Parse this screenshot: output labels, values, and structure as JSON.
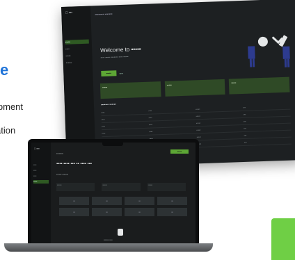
{
  "background_text": {
    "heading": "e",
    "line1": "ipment",
    "line2": "ation"
  },
  "monitor": {
    "sidebar": {
      "logo": "□ ▪▪▪",
      "items": [
        "▪▪▪▪▪",
        "▪▪▪▪",
        "▪▪▪▪▪",
        "▪▪▪▪▪▪"
      ]
    },
    "header": "▪▪▪▪▪▪▪▪    ▪▪▪▪▪▪▪",
    "hero": {
      "title": "Welcome to ▪▪▪▪▪",
      "subtitle": "▪▪▪▪ ▪▪▪▪▪ ▪▪▪▪▪▪▪ ▪▪▪▪ ▪▪▪▪▪",
      "button": "▪▪▪▪▪",
      "link": "▪▪▪▪"
    },
    "cards": [
      "▪▪▪▪▪",
      "▪▪▪▪▪",
      "▪▪▪▪▪"
    ],
    "table": {
      "title": "▪▪▪▪▪▪▪ ▪▪▪▪▪▪",
      "rows": [
        [
          "▪▪▪▪",
          "▪▪▪▪",
          "▪▪▪▪▪",
          "▪▪▪"
        ],
        [
          "▪▪▪▪",
          "▪▪▪▪",
          "▪▪▪▪▪",
          "▪▪▪"
        ],
        [
          "▪▪▪▪",
          "▪▪▪▪",
          "▪▪▪▪▪",
          "▪▪▪"
        ],
        [
          "▪▪▪▪",
          "▪▪▪▪",
          "▪▪▪▪▪",
          "▪▪▪"
        ],
        [
          "▪▪▪▪",
          "▪▪▪▪",
          "▪▪▪▪▪",
          "▪▪▪"
        ],
        [
          "▪▪▪▪",
          "▪▪▪▪",
          "▪▪▪▪▪",
          "▪▪▪"
        ]
      ]
    }
  },
  "laptop": {
    "sidebar": {
      "logo": "□ ▪▪▪",
      "items": [
        "▪▪▪▪",
        "▪▪▪▪",
        "▪▪▪▪",
        "▪▪▪▪▪"
      ]
    },
    "breadcrumb": "▪▪▪▪▪▪▪▪",
    "button": "▪▪▪▪▪",
    "title": "▪▪▪▪ ▪▪▪▪ ▪▪▪ ▪▪ ▪▪▪▪ ▪▪▪",
    "section_label": "▪▪▪▪▪▪ ▪▪▪▪▪▪▪",
    "fields": [
      "▪▪▪▪▪▪",
      "▪▪▪▪▪▪",
      "▪▪▪▪▪▪"
    ],
    "tiles": [
      "▪▪",
      "▪▪",
      "▪▪",
      "▪▪",
      "▪▪",
      "▪▪",
      "▪▪",
      "▪▪"
    ],
    "upload_text": "▪▪▪▪▪▪▪ ▪▪▪▪"
  },
  "colors": {
    "accent_green": "#5da635",
    "heading_blue": "#1e73d8"
  },
  "icons": {
    "hero_art": "robot-wrench-icon",
    "upload": "upload-icon"
  }
}
